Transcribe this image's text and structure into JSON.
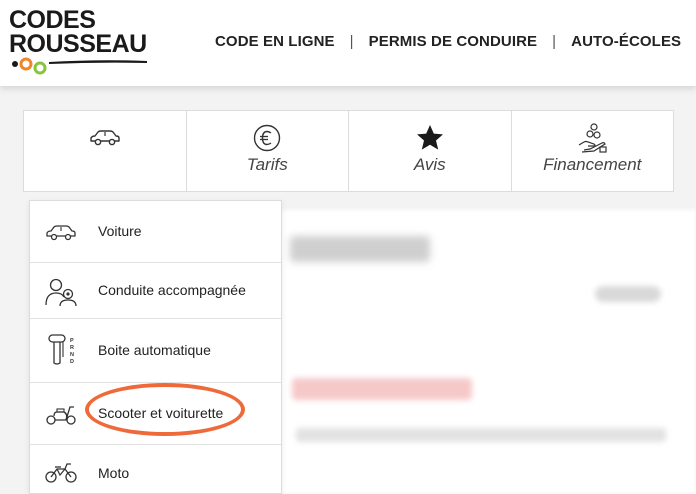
{
  "header": {
    "logo_line1": "CODES",
    "logo_line2": "ROUSSEAU",
    "nav": [
      {
        "label": "CODE EN LIGNE"
      },
      {
        "label": "PERMIS DE CONDUIRE"
      },
      {
        "label": "AUTO-ÉCOLES"
      }
    ],
    "nav_separator": "|"
  },
  "tabs": [
    {
      "label": "",
      "icon": "car-icon"
    },
    {
      "label": "Tarifs",
      "icon": "euro-icon"
    },
    {
      "label": "Avis",
      "icon": "star-icon"
    },
    {
      "label": "Financement",
      "icon": "hand-coins-icon"
    }
  ],
  "dropdown": {
    "items": [
      {
        "label": "Voiture",
        "icon": "car-icon"
      },
      {
        "label": "Conduite accompagnée",
        "icon": "people-icon"
      },
      {
        "label": "Boite automatique",
        "icon": "gear-shifter-icon"
      },
      {
        "label": "Scooter et voiturette",
        "icon": "scooter-icon",
        "highlighted": true
      },
      {
        "label": "Moto",
        "icon": "motorcycle-icon"
      }
    ]
  },
  "colors": {
    "highlight": "#ee6a3a",
    "logo_orange": "#f0862a",
    "logo_green": "#8ac43f",
    "text": "#222222"
  }
}
